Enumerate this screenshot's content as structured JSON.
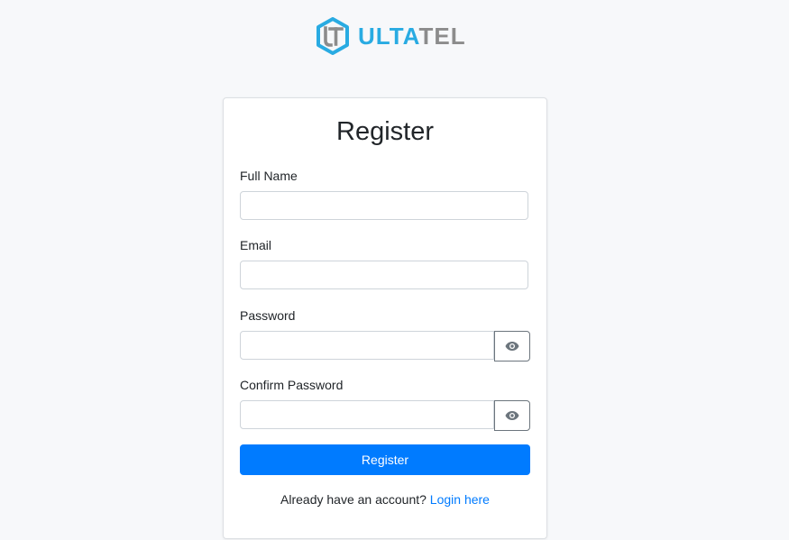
{
  "brand": {
    "name_part1": "ULTA",
    "name_part2": "TEL",
    "primary_color": "#29abe2",
    "secondary_color": "#8c8c8c",
    "logo_icon": "ut-hexagon-logo-icon"
  },
  "form": {
    "title": "Register",
    "full_name": {
      "label": "Full Name",
      "value": "",
      "placeholder": ""
    },
    "email": {
      "label": "Email",
      "value": "",
      "placeholder": ""
    },
    "password": {
      "label": "Password",
      "value": "",
      "placeholder": "",
      "toggle_icon": "eye-icon"
    },
    "confirm_password": {
      "label": "Confirm Password",
      "value": "",
      "placeholder": "",
      "toggle_icon": "eye-icon"
    },
    "submit_label": "Register",
    "submit_color": "#007bff",
    "footer_text": "Already have an account?",
    "login_link_label": "Login here"
  }
}
